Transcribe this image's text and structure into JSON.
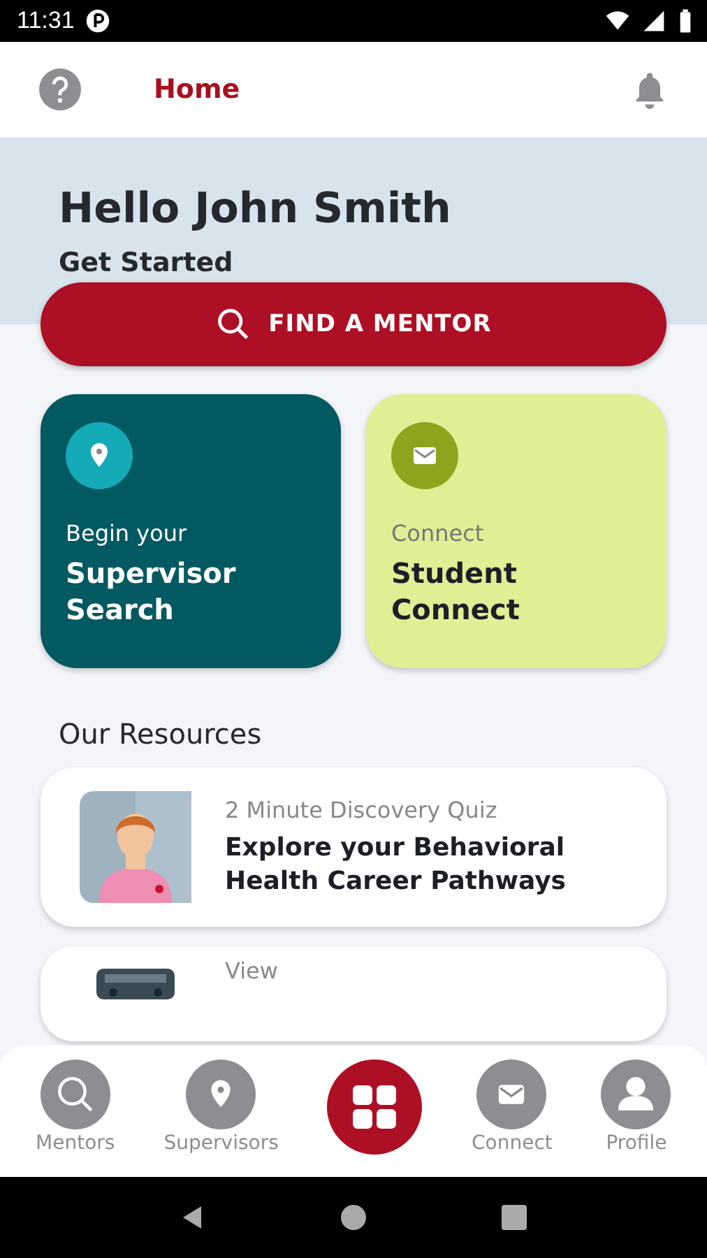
{
  "status_bar": {
    "time": "11:31"
  },
  "header": {
    "title": "Home"
  },
  "greeting": {
    "title": "Hello John Smith",
    "subtitle": "Get Started"
  },
  "find_button": {
    "label": "FIND A MENTOR"
  },
  "tiles": [
    {
      "kind": "dark",
      "caption": "Begin your",
      "title": "Supervisor Search"
    },
    {
      "kind": "light",
      "caption": "Connect",
      "title": "Student Connect"
    }
  ],
  "resources": {
    "heading": "Our Resources",
    "items": [
      {
        "caption": "2 Minute Discovery Quiz",
        "title": "Explore your Behavioral Health Career Pathways"
      },
      {
        "caption": "View"
      }
    ]
  },
  "bottom_nav": [
    {
      "label": "Mentors",
      "selected": false
    },
    {
      "label": "Supervisors",
      "selected": false
    },
    {
      "selected": true
    },
    {
      "label": "Connect",
      "selected": false
    },
    {
      "label": "Profile",
      "selected": false
    }
  ]
}
